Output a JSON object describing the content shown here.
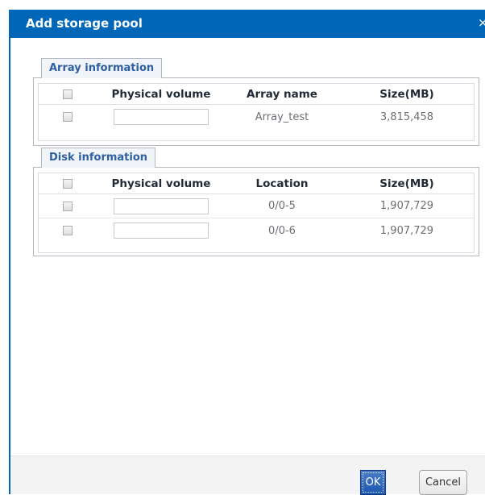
{
  "dialog": {
    "title": "Add storage pool",
    "close_glyph": "×"
  },
  "array_section": {
    "tab_label": "Array information",
    "columns": [
      "Physical volume",
      "Array name",
      "Size(MB)"
    ],
    "rows": [
      {
        "physical_volume": "",
        "array_name": "Array_test",
        "size_mb": "3,815,458"
      }
    ]
  },
  "disk_section": {
    "tab_label": "Disk information",
    "columns": [
      "Physical volume",
      "Location",
      "Size(MB)"
    ],
    "rows": [
      {
        "physical_volume": "",
        "location": "0/0-5",
        "size_mb": "1,907,729"
      },
      {
        "physical_volume": "",
        "location": "0/0-6",
        "size_mb": "1,907,729"
      }
    ]
  },
  "footer": {
    "ok_label": "OK",
    "cancel_label": "Cancel"
  },
  "colors": {
    "titlebar": "#0067b8",
    "tab_text": "#2d5fa1",
    "ok_button": "#1b56b0"
  }
}
